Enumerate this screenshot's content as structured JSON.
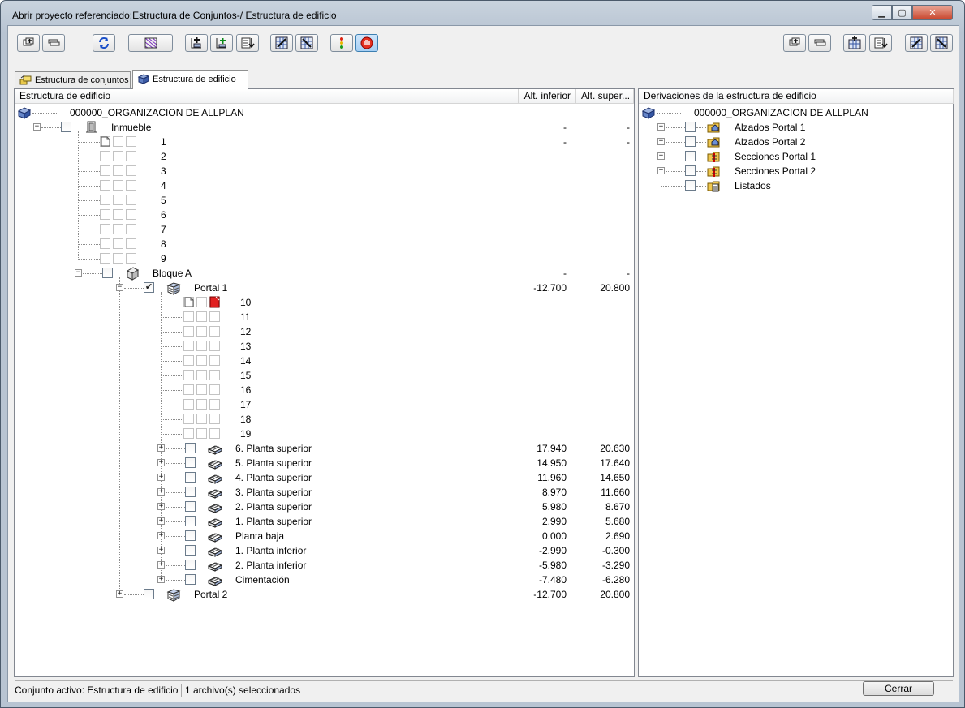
{
  "window": {
    "title": "Abrir proyecto referenciado:Estructura de Conjuntos-/ Estructura de edificio",
    "minimize_glyph": "▁",
    "maximize_glyph": "▢",
    "close_glyph": "✕"
  },
  "toolbar_left": [
    {
      "name": "add-set-button",
      "icon": "add-layers-icon",
      "active": false
    },
    {
      "name": "remove-set-button",
      "icon": "remove-layers-icon",
      "active": false
    },
    {
      "name": "refresh-button",
      "icon": "refresh-arrows-icon",
      "active": false
    },
    {
      "name": "filter-button",
      "icon": "hatch-grid-icon",
      "active": false
    },
    {
      "name": "insert-structure-button",
      "icon": "insert-level-icon",
      "active": false
    },
    {
      "name": "insert-sub-structure-button",
      "icon": "insert-sublevel-icon",
      "active": false
    },
    {
      "name": "import-structure-button",
      "icon": "import-list-icon",
      "active": false
    },
    {
      "name": "assign-structure-button",
      "icon": "assign-grid-icon",
      "active": false
    },
    {
      "name": "reassign-structure-button",
      "icon": "reassign-grid-icon",
      "active": false
    },
    {
      "name": "color-status-button",
      "icon": "traffic-light-icon",
      "active": false
    },
    {
      "name": "hide-button",
      "icon": "hand-stop-icon",
      "active": true
    }
  ],
  "toolbar_right": [
    {
      "name": "add-derivation-button",
      "icon": "add-layers-icon"
    },
    {
      "name": "remove-derivation-button",
      "icon": "remove-layers-icon"
    },
    {
      "name": "derive-view-button",
      "icon": "derive-grid-icon"
    },
    {
      "name": "import-derivation-button",
      "icon": "import-list-icon"
    },
    {
      "name": "assign-derivation-button",
      "icon": "assign-grid-icon"
    },
    {
      "name": "reassign-derivation-button",
      "icon": "reassign-grid-icon"
    }
  ],
  "tabs": [
    {
      "label": "Estructura de conjuntos",
      "selected": false,
      "icon": "sets-icon"
    },
    {
      "label": "Estructura de edificio",
      "selected": true,
      "icon": "building-icon"
    }
  ],
  "left_pane": {
    "headers": {
      "name": "Estructura de edificio",
      "low": "Alt. inferior",
      "high": "Alt. super..."
    },
    "root": "000000_ORGANIZACION DE ALLPLAN",
    "inmueble": {
      "label": "Inmueble",
      "low": "-",
      "high": "-"
    },
    "inmueble_files": [
      {
        "label": "1",
        "low": "-",
        "high": "-"
      },
      {
        "label": "2"
      },
      {
        "label": "3"
      },
      {
        "label": "4"
      },
      {
        "label": "5"
      },
      {
        "label": "6"
      },
      {
        "label": "7"
      },
      {
        "label": "8"
      },
      {
        "label": "9"
      }
    ],
    "bloque": {
      "label": "Bloque A",
      "low": "-",
      "high": "-"
    },
    "portal1": {
      "label": "Portal 1",
      "low": "-12.700",
      "high": "20.800"
    },
    "portal_files": [
      {
        "label": "10"
      },
      {
        "label": "11"
      },
      {
        "label": "12"
      },
      {
        "label": "13"
      },
      {
        "label": "14"
      },
      {
        "label": "15"
      },
      {
        "label": "16"
      },
      {
        "label": "17"
      },
      {
        "label": "18"
      },
      {
        "label": "19"
      }
    ],
    "floors": [
      {
        "label": "6. Planta superior",
        "low": "17.940",
        "high": "20.630"
      },
      {
        "label": "5. Planta superior",
        "low": "14.950",
        "high": "17.640"
      },
      {
        "label": "4. Planta superior",
        "low": "11.960",
        "high": "14.650"
      },
      {
        "label": "3. Planta superior",
        "low": "8.970",
        "high": "11.660"
      },
      {
        "label": "2. Planta superior",
        "low": "5.980",
        "high": "8.670"
      },
      {
        "label": "1. Planta superior",
        "low": "2.990",
        "high": "5.680"
      },
      {
        "label": "Planta baja",
        "low": "0.000",
        "high": "2.690"
      },
      {
        "label": "1. Planta inferior",
        "low": "-2.990",
        "high": "-0.300"
      },
      {
        "label": "2. Planta inferior",
        "low": "-5.980",
        "high": "-3.290"
      },
      {
        "label": "Cimentación",
        "low": "-7.480",
        "high": "-6.280"
      }
    ],
    "portal2": {
      "label": "Portal 2",
      "low": "-12.700",
      "high": "20.800"
    }
  },
  "right_pane": {
    "header": "Derivaciones de la estructura de edificio",
    "root": "000000_ORGANIZACION DE ALLPLAN",
    "items": [
      {
        "label": "Alzados Portal 1",
        "icon": "elevation-folder-icon"
      },
      {
        "label": "Alzados Portal 2",
        "icon": "elevation-folder-icon"
      },
      {
        "label": "Secciones Portal 1",
        "icon": "section-folder-icon"
      },
      {
        "label": "Secciones Portal 2",
        "icon": "section-folder-icon"
      },
      {
        "label": "Listados",
        "icon": "list-folder-icon"
      }
    ]
  },
  "status": {
    "active_set": "Conjunto activo: Estructura de edificio",
    "selected_files": "1 archivo(s) seleccionados",
    "close_label": "Cerrar"
  }
}
